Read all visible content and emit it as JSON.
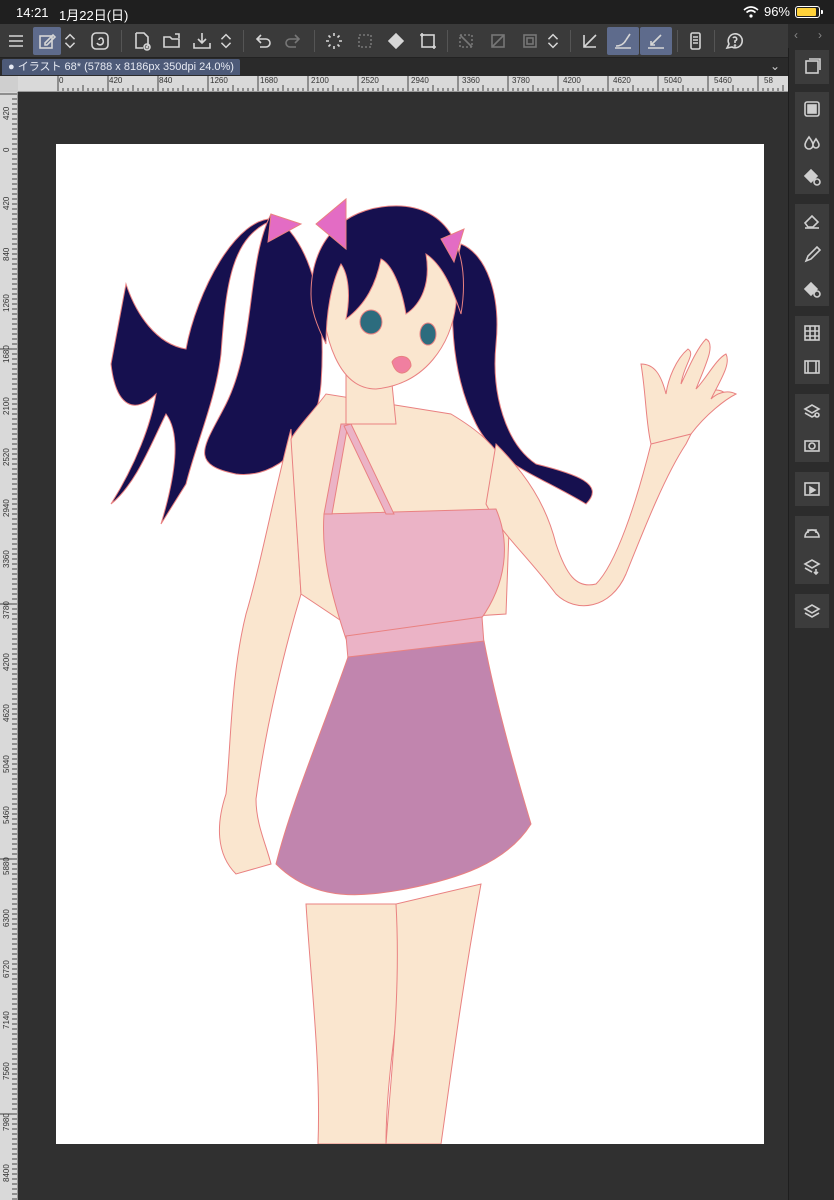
{
  "status": {
    "time": "14:21",
    "date": "1月22日(日)",
    "battery": "96%"
  },
  "tab": {
    "title": "イラスト 68* (5788 x 8186px 350dpi 24.0%)"
  },
  "toolbar": {
    "icons": [
      "menu-icon",
      "quick-access-icon",
      "chevron-updown-icon",
      "companion-icon",
      "new-file-icon",
      "open-file-icon",
      "save-file-icon",
      "chevron-updown-icon",
      "undo-icon",
      "redo-icon",
      "loading-icon",
      "select-all-icon",
      "fill-icon",
      "transform-icon",
      "deselect-icon",
      "invert-selection-icon",
      "selection-border-icon",
      "chevron-updown-icon",
      "snap-ruler-icon",
      "snap-special-ruler-icon",
      "snap-grid-icon",
      "smartphone-icon",
      "help-icon"
    ]
  },
  "hruler": {
    "labels": [
      "0",
      "420",
      "840",
      "1260",
      "1680",
      "2100",
      "2520",
      "2940",
      "3360",
      "3780",
      "4200",
      "4620",
      "5040",
      "5460",
      "58"
    ]
  },
  "vruler": {
    "labels": [
      "420",
      "0",
      "420",
      "840",
      "1260",
      "1680",
      "2100",
      "2520",
      "2940",
      "3360",
      "3780",
      "4200",
      "4620",
      "5040",
      "5460",
      "5880",
      "6300",
      "6720",
      "7140",
      "7560",
      "7980",
      "8400"
    ]
  },
  "rightpanel": {
    "icons": [
      "layer-icon",
      "navigator-icon",
      "color-drop-icon",
      "fill-circle-icon",
      "eraser-icon",
      "pen-icon",
      "brush-settings-icon",
      "palette-grid-icon",
      "filmstrip-icon",
      "material-icon",
      "camera-icon",
      "timeline-icon",
      "assets-icon",
      "layer-download-icon",
      "layers-stack-icon"
    ]
  },
  "colors": {
    "accent": "#5e6b8c",
    "hair": "#16104f",
    "skin": "#fae6cf",
    "top": "#ebb3c6",
    "skirt": "#c185ae",
    "bow": "#e36cc4",
    "line": "#e98181"
  }
}
